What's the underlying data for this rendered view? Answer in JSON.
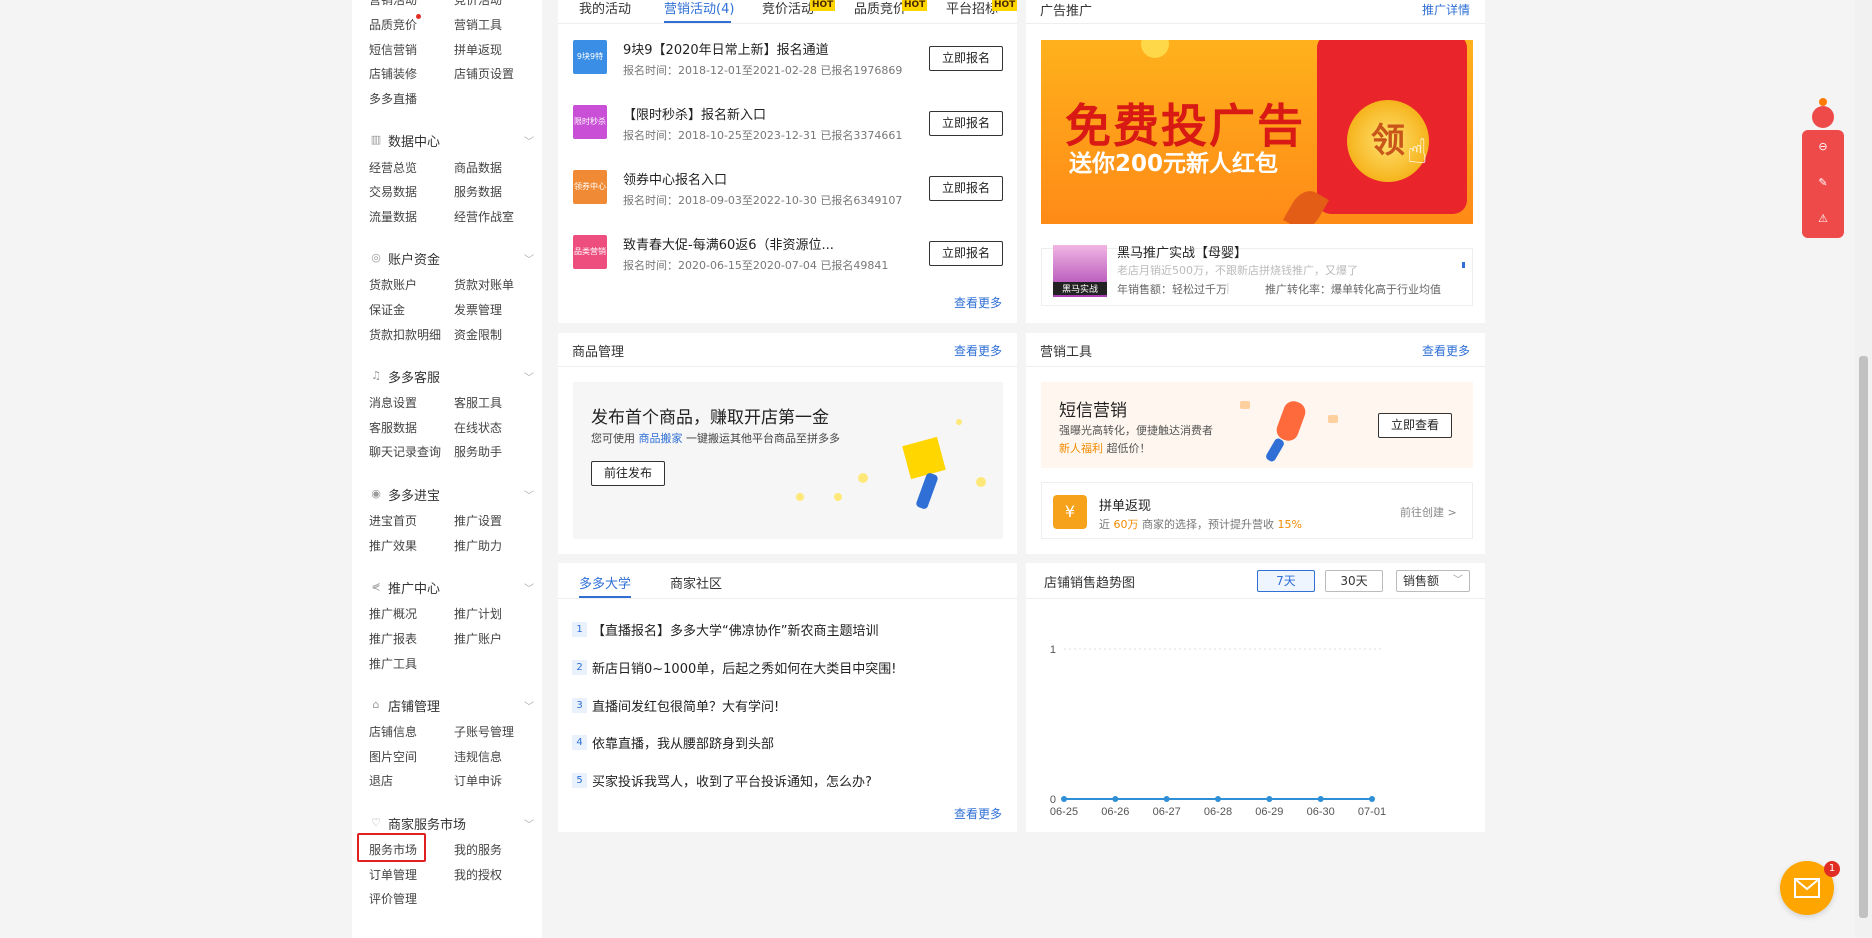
{
  "sidebar": {
    "top_items": [
      "营销活动",
      "竞价活动",
      "品质竞价",
      "营销工具",
      "短信营销",
      "拼单返现",
      "店铺装修",
      "店铺页设置",
      "多多直播"
    ],
    "groups": [
      {
        "title": "数据中心",
        "icon": "chart-icon",
        "items": [
          "经营总览",
          "商品数据",
          "交易数据",
          "服务数据",
          "流量数据",
          "经营作战室"
        ]
      },
      {
        "title": "账户资金",
        "icon": "wallet-icon",
        "items": [
          "货款账户",
          "货款对账单",
          "保证金",
          "发票管理",
          "货款扣款明细",
          "资金限制"
        ]
      },
      {
        "title": "多多客服",
        "icon": "headset-icon",
        "items": [
          "消息设置",
          "客服工具",
          "客服数据",
          "在线状态",
          "聊天记录查询",
          "服务助手"
        ]
      },
      {
        "title": "多多进宝",
        "icon": "piggy-icon",
        "items": [
          "进宝首页",
          "推广设置",
          "推广效果",
          "推广助力"
        ]
      },
      {
        "title": "推广中心",
        "icon": "share-icon",
        "items": [
          "推广概况",
          "推广计划",
          "推广报表",
          "推广账户",
          "推广工具"
        ]
      },
      {
        "title": "店铺管理",
        "icon": "store-icon",
        "items": [
          "店铺信息",
          "子账号管理",
          "图片空间",
          "违规信息",
          "退店",
          "订单申诉"
        ]
      },
      {
        "title": "商家服务市场",
        "icon": "heart-icon",
        "items": [
          "服务市场",
          "我的服务",
          "订单管理",
          "我的授权",
          "评价管理"
        ]
      }
    ]
  },
  "activity": {
    "tabs": [
      "我的活动",
      "营销活动(4)",
      "竞价活动",
      "品质竞价",
      "平台招标"
    ],
    "hot_badge": "HOT",
    "items": [
      {
        "name": "9块9【2020年日常上新】报名通道",
        "meta": "报名时间：2018-12-01至2021-02-28  已报名1976869",
        "icon_label": "9块9特卖",
        "color": "#3a8ee6",
        "button": "立即报名"
      },
      {
        "name": "【限时秒杀】报名新入口",
        "meta": "报名时间：2018-10-25至2023-12-31  已报名3374661",
        "icon_label": "限时秒杀",
        "color": "#c94fd6",
        "button": "立即报名"
      },
      {
        "name": "领券中心报名入口",
        "meta": "报名时间：2018-09-03至2022-10-30  已报名6349107",
        "icon_label": "领券中心",
        "color": "#f08a35",
        "button": "立即报名"
      },
      {
        "name": "致青春大促-每满60返6（非资源位...",
        "meta": "报名时间：2020-06-15至2020-07-04  已报名49841",
        "icon_label": "品类营销",
        "color": "#ee4e7e",
        "button": "立即报名"
      }
    ],
    "more": "查看更多"
  },
  "ad": {
    "title": "广告推广",
    "detail": "推广详情",
    "banner_line1": "免费投广告",
    "banner_line2": "送你200元新人红包",
    "coin_text": "领",
    "promo_title": "黑马推广实战【母婴】",
    "promo_sub": "老店月销近500万，不跟新店拼烧钱推广，又爆了",
    "promo_stat1": "年销售额：轻松过千万",
    "promo_stat2": "推广转化率：爆单转化高于行业均值",
    "promo_thumb_label": "黑马实战"
  },
  "goods": {
    "title": "商品管理",
    "more": "查看更多",
    "headline": "发布首个商品，赚取开店第一金",
    "desc_pre": "您可使用",
    "desc_link": "商品搬家",
    "desc_post": "一键搬运其他平台商品至拼多多",
    "button": "前往发布"
  },
  "tools": {
    "title": "营销工具",
    "more": "查看更多",
    "sms_title": "短信营销",
    "sms_desc1": "强曝光高转化，便捷触达消费者",
    "sms_hl": "新人福利",
    "sms_desc2": "超低价！",
    "sms_button": "立即查看",
    "cash_title": "拼单返现",
    "cash_pre": "近",
    "cash_hl1": "60万",
    "cash_mid": "商家的选择，预计提升营收",
    "cash_hl2": "15%",
    "cash_link": "前往创建 >"
  },
  "university": {
    "tabs": [
      "多多大学",
      "商家社区"
    ],
    "items": [
      "【直播报名】多多大学“佛凉协作”新农商主题培训",
      "新店日销0~1000单，后起之秀如何在大类目中突围!",
      "直播间发红包很简单？大有学问!",
      "依靠直播，我从腰部跻身到头部",
      "买家投诉我骂人，收到了平台投诉通知，怎么办?"
    ],
    "more": "查看更多"
  },
  "trend": {
    "title": "店铺销售趋势图",
    "range_options": [
      "7天",
      "30天"
    ],
    "selected_range": "7天",
    "metric_select": "销售额"
  },
  "chart_data": {
    "type": "line",
    "x": [
      "06-25",
      "06-26",
      "06-27",
      "06-28",
      "06-29",
      "06-30",
      "07-01"
    ],
    "series": [
      {
        "values": [
          0,
          0,
          0,
          0,
          0,
          0,
          0
        ]
      }
    ],
    "yticks": [
      "1",
      "0"
    ],
    "ylim": [
      0,
      1
    ],
    "color": "#2f8fd6"
  },
  "floating": {
    "mail_badge": "1"
  },
  "colors": {
    "accent": "#2f6fd6",
    "brand_red": "#e02e24",
    "orange": "#ffa500"
  }
}
